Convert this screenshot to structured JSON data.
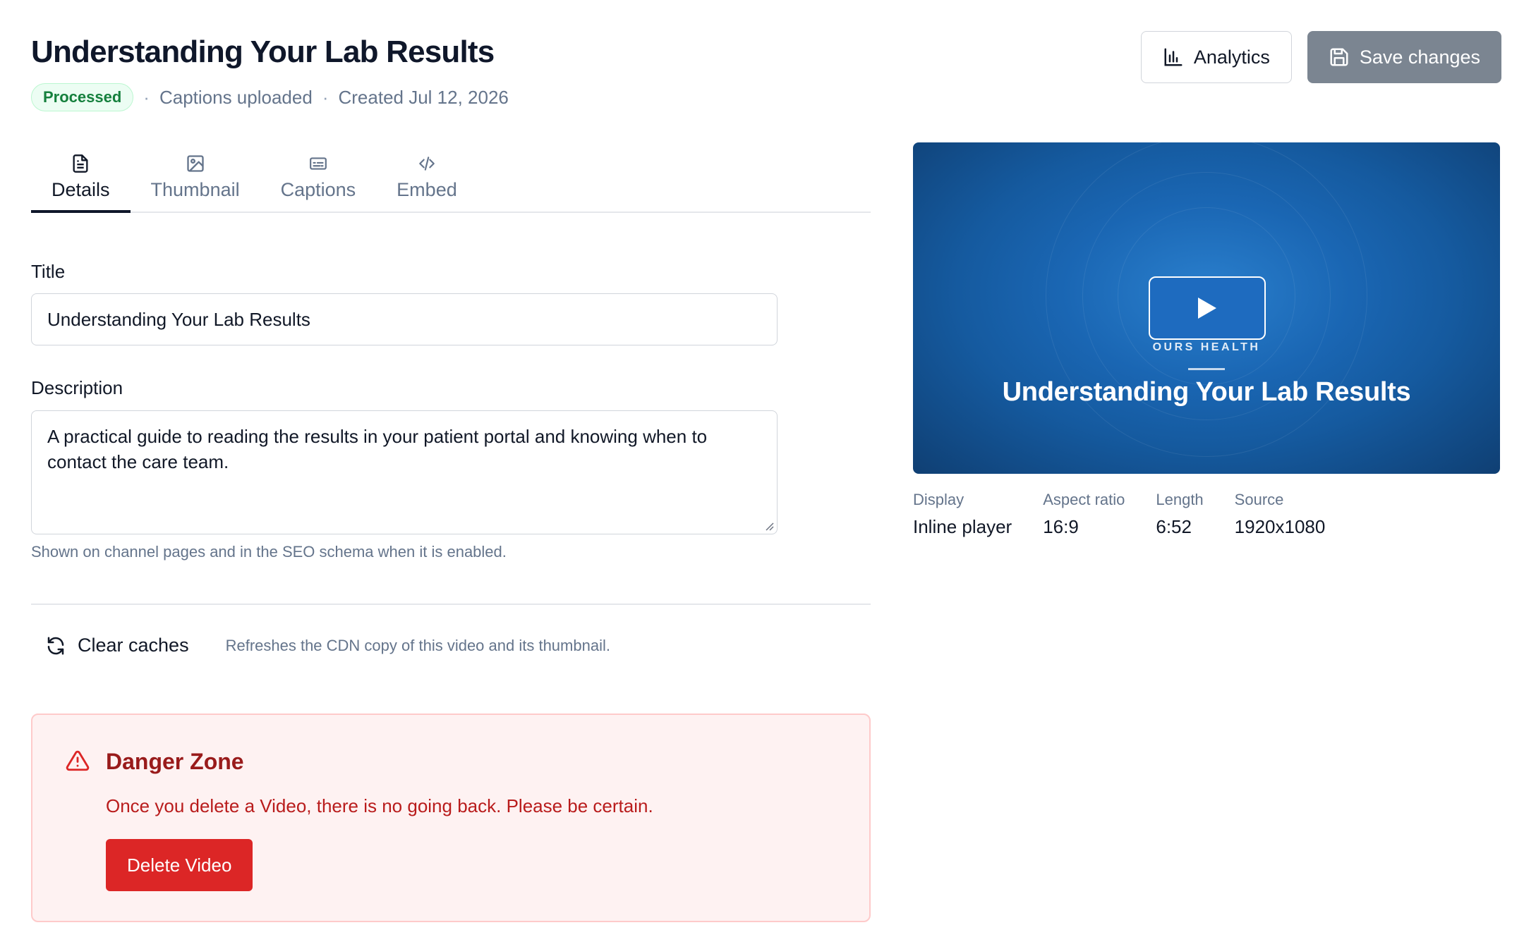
{
  "header": {
    "title": "Understanding Your Lab Results",
    "status_badge": "Processed",
    "captions_status": "Captions uploaded",
    "created": "Created Jul 12, 2026",
    "analytics_label": "Analytics",
    "save_label": "Save changes"
  },
  "tabs": [
    {
      "label": "Details",
      "icon": "document-icon",
      "active": true
    },
    {
      "label": "Thumbnail",
      "icon": "image-icon",
      "active": false
    },
    {
      "label": "Captions",
      "icon": "captions-icon",
      "active": false
    },
    {
      "label": "Embed",
      "icon": "code-icon",
      "active": false
    }
  ],
  "form": {
    "title_label": "Title",
    "title_value": "Understanding Your Lab Results",
    "description_label": "Description",
    "description_value": "A practical guide to reading the results in your patient portal and knowing when to contact the care team.",
    "description_help": "Shown on channel pages and in the SEO schema when it is enabled."
  },
  "cache": {
    "button_label": "Clear caches",
    "description": "Refreshes the CDN copy of this video and its thumbnail."
  },
  "danger": {
    "title": "Danger Zone",
    "text": "Once you delete a Video, there is no going back. Please be certain.",
    "delete_label": "Delete Video"
  },
  "preview": {
    "brand": "OURS HEALTH",
    "title": "Understanding Your Lab Results"
  },
  "stats": [
    {
      "label": "Display",
      "value": "Inline player"
    },
    {
      "label": "Aspect ratio",
      "value": "16:9"
    },
    {
      "label": "Length",
      "value": "6:52"
    },
    {
      "label": "Source",
      "value": "1920x1080"
    }
  ],
  "colors": {
    "accent": "#0f172a",
    "success": "#15803d",
    "danger": "#dc2626",
    "save_button": "#7b8591",
    "preview_blue": "#1a66b3"
  }
}
